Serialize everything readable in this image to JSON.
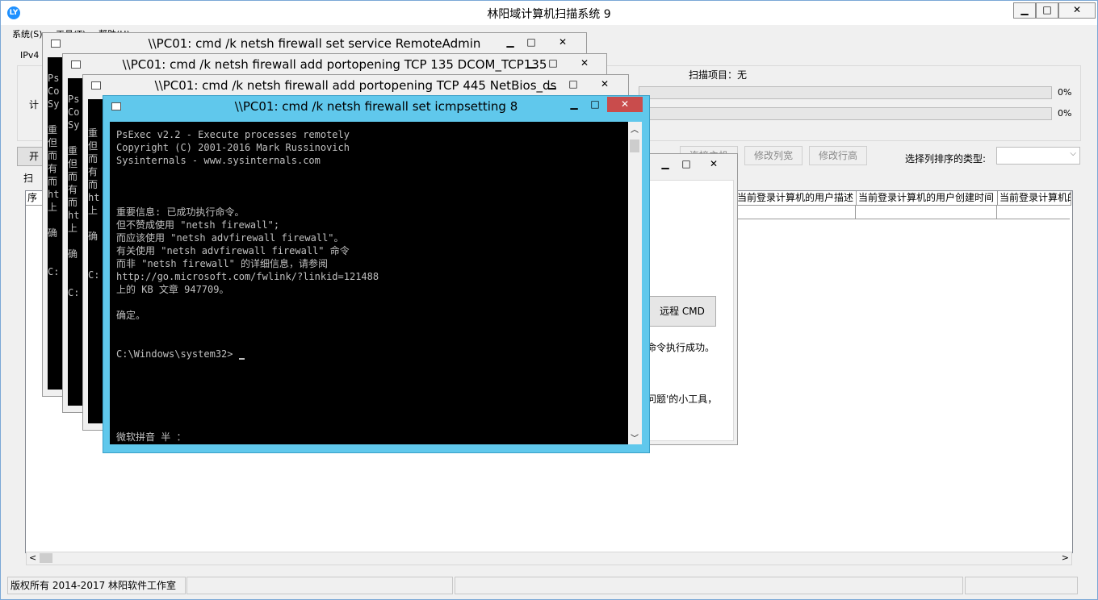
{
  "app": {
    "title": "林阳域计算机扫描系统 9",
    "icon_text": "LY",
    "menu": [
      "系统(S)",
      "工具(T)",
      "帮助(H)"
    ],
    "tab_ipv4": "IPv4",
    "label_compute_prefix": "计",
    "scan_items_label": "扫描项目：无",
    "progress": [
      {
        "value": 0,
        "label": "0%"
      },
      {
        "value": 0,
        "label": "0%"
      }
    ],
    "start_btn_prefix": "开",
    "scan_label_prefix": "扫",
    "btn_connect": "连接主机",
    "btn_edit_col": "修改列宽",
    "btn_edit_row": "修改行高",
    "sort_label": "选择列排序的类型:",
    "sort_value": "",
    "col_seq_prefix": "序",
    "columns_right": [
      "当前登录计算机的用户描述",
      "当前登录计算机的用户创建时间",
      "当前登录计算机的"
    ]
  },
  "status": {
    "copyright": "版权所有 2014-2017 林阳软件工作室"
  },
  "helper_dialog": {
    "remote_cmd": "远程 CMD",
    "text_success": "命令执行成功。",
    "text_tool": "问题'的小工具，"
  },
  "bg_cmd_windows": [
    {
      "title": "\\\\PC01: cmd /k netsh firewall set service RemoteAdmin"
    },
    {
      "title": "\\\\PC01: cmd /k netsh firewall add portopening TCP 135 DCOM_TCP135"
    },
    {
      "title": "\\\\PC01: cmd /k netsh firewall add portopening TCP 445 NetBios_ds"
    }
  ],
  "peek_text": {
    "w1": [
      "Ps",
      "Co",
      "Sy",
      "",
      "重",
      "但",
      "而",
      "有",
      "而",
      "ht",
      "上",
      "",
      "确",
      "",
      "",
      "C:"
    ],
    "w2": [
      "Ps",
      "Co",
      "Sy",
      "",
      "重",
      "但",
      "而",
      "有",
      "而",
      "ht",
      "上",
      "",
      "确",
      "",
      "",
      "C:"
    ],
    "w3": [
      "",
      "重",
      "但",
      "而",
      "有",
      "而",
      "ht",
      "上",
      "",
      "确",
      "",
      "",
      "C:"
    ]
  },
  "cmd": {
    "title": "\\\\PC01: cmd /k netsh firewall set icmpsetting 8",
    "lines": [
      "PsExec v2.2 - Execute processes remotely",
      "Copyright (C) 2001-2016 Mark Russinovich",
      "Sysinternals - www.sysinternals.com",
      "",
      "",
      "",
      "重要信息: 已成功执行命令。",
      "但不赞成使用 \"netsh firewall\";",
      "而应该使用 \"netsh advfirewall firewall\"。",
      "有关使用 \"netsh advfirewall firewall\" 命令",
      "而非 \"netsh firewall\" 的详细信息，请参阅",
      "http://go.microsoft.com/fwlink/?linkid=121488",
      "上的 KB 文章 947709。",
      "",
      "确定。",
      "",
      "",
      "C:\\Windows\\system32>"
    ],
    "ime": "微软拼音 半 ："
  },
  "colors": {
    "active_frame": "#60c8ec",
    "close_red": "#c94c4c"
  }
}
